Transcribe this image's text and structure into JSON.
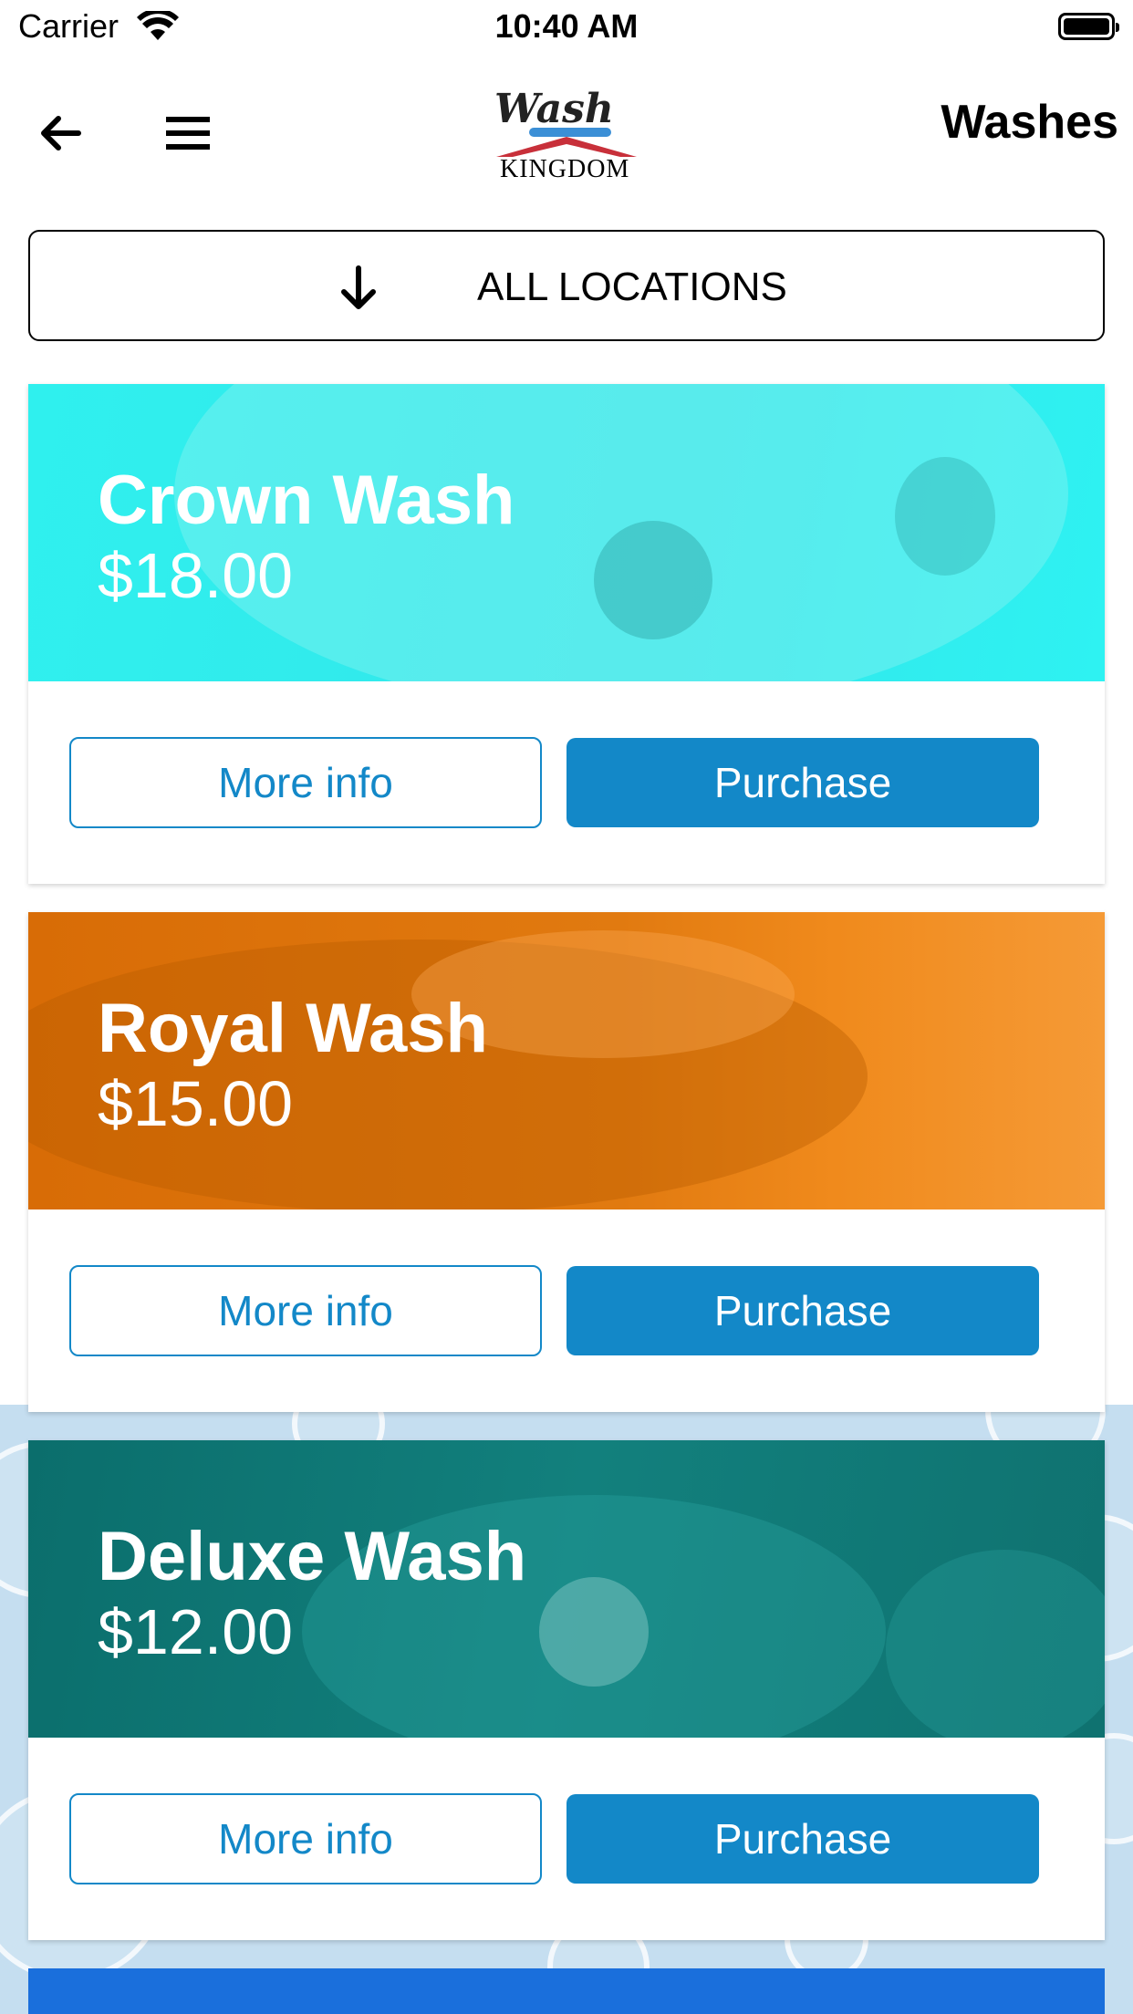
{
  "status": {
    "carrier": "Carrier",
    "time": "10:40 AM"
  },
  "nav": {
    "back_icon": "arrow-left-icon",
    "menu_icon": "hamburger-menu-icon",
    "logo": {
      "script": "Wash",
      "text": "KINGDOM"
    },
    "title": "Washes"
  },
  "locations": {
    "label": "ALL LOCATIONS",
    "icon": "arrow-down-icon"
  },
  "colors": {
    "accent": "#1388c8",
    "crown": "#2ff0ee",
    "royal": "#f08a1c",
    "deluxe": "#0f7a77"
  },
  "washes": [
    {
      "title": "Crown Wash",
      "price": "$18.00",
      "info": "More info",
      "purchase": "Purchase"
    },
    {
      "title": "Royal Wash",
      "price": "$15.00",
      "info": "More info",
      "purchase": "Purchase"
    },
    {
      "title": "Deluxe Wash",
      "price": "$12.00",
      "info": "More info",
      "purchase": "Purchase"
    }
  ]
}
